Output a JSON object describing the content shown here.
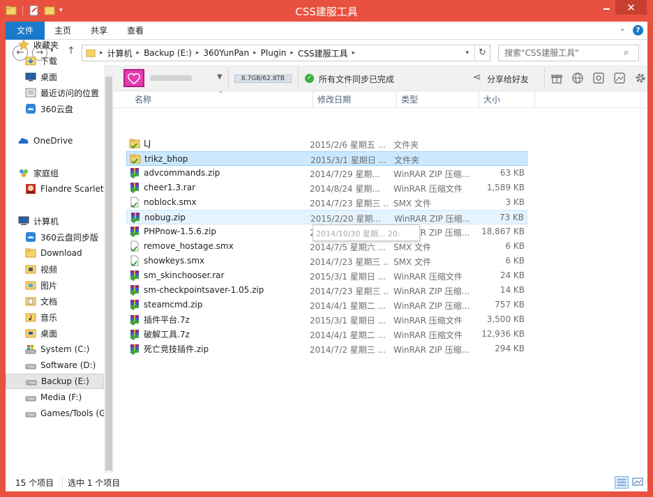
{
  "window": {
    "title": "CSS建服工具"
  },
  "ribbon": {
    "tabs": [
      "文件",
      "主页",
      "共享",
      "查看"
    ]
  },
  "address": {
    "crumbs": [
      "计算机",
      "Backup (E:)",
      "360YunPan",
      "Plugin",
      "CSS建服工具"
    ],
    "search_placeholder": "搜索\"CSS建服工具\""
  },
  "nav": {
    "items": [
      {
        "label": "收藏夹",
        "icon": "star-icon",
        "indent": 0
      },
      {
        "label": "下载",
        "icon": "download-folder-icon",
        "indent": 1
      },
      {
        "label": "桌面",
        "icon": "desktop-icon",
        "indent": 1
      },
      {
        "label": "最近访问的位置",
        "icon": "recent-places-icon",
        "indent": 1
      },
      {
        "label": "360云盘",
        "icon": "cloud-drive-icon",
        "indent": 1
      },
      {
        "label": "OneDrive",
        "icon": "onedrive-icon",
        "indent": 0
      },
      {
        "label": "家庭组",
        "icon": "homegroup-icon",
        "indent": 0
      },
      {
        "label": "Flandre Scarlet",
        "icon": "user-avatar-icon",
        "indent": 1
      },
      {
        "label": "计算机",
        "icon": "computer-icon",
        "indent": 0
      },
      {
        "label": "360云盘同步版",
        "icon": "cloud-drive-icon",
        "indent": 1
      },
      {
        "label": "Download",
        "icon": "folder-icon",
        "indent": 1
      },
      {
        "label": "视频",
        "icon": "videos-folder-icon",
        "indent": 1
      },
      {
        "label": "图片",
        "icon": "pictures-folder-icon",
        "indent": 1
      },
      {
        "label": "文档",
        "icon": "documents-folder-icon",
        "indent": 1
      },
      {
        "label": "音乐",
        "icon": "music-folder-icon",
        "indent": 1
      },
      {
        "label": "桌面",
        "icon": "desktop-folder-icon",
        "indent": 1
      },
      {
        "label": "System (C:)",
        "icon": "system-drive-icon",
        "indent": 1
      },
      {
        "label": "Software (D:)",
        "icon": "drive-icon",
        "indent": 1
      },
      {
        "label": "Backup (E:)",
        "icon": "drive-icon",
        "indent": 1
      },
      {
        "label": "Media (F:)",
        "icon": "drive-icon",
        "indent": 1
      },
      {
        "label": "Games/Tools (G",
        "icon": "drive-icon",
        "indent": 1
      }
    ]
  },
  "toolbar360": {
    "quota": "8.7GB/62.8TB",
    "sync_status": "所有文件同步已完成",
    "share_label": "分享给好友",
    "accent": "#cc2a9a"
  },
  "columns": {
    "name": "名称",
    "date": "修改日期",
    "type": "类型",
    "size": "大小"
  },
  "files": [
    {
      "name": "LJ",
      "date": "2015/2/6 星期五 ...",
      "type": "文件夹",
      "size": "",
      "icon": "folder-icon",
      "state": ""
    },
    {
      "name": "trikz_bhop",
      "date": "2015/3/1 星期日 ...",
      "type": "文件夹",
      "size": "",
      "icon": "folder-icon",
      "state": "selected"
    },
    {
      "name": "advcommands.zip",
      "date": "2014/7/29 星期...",
      "type": "WinRAR ZIP 压缩...",
      "size": "63 KB",
      "icon": "winrar-icon",
      "state": ""
    },
    {
      "name": "cheer1.3.rar",
      "date": "2014/8/24 星期...",
      "type": "WinRAR 压缩文件",
      "size": "1,589 KB",
      "icon": "winrar-icon",
      "state": ""
    },
    {
      "name": "noblock.smx",
      "date": "2014/7/23 星期三 ...",
      "type": "SMX 文件",
      "size": "3 KB",
      "icon": "file-icon",
      "state": ""
    },
    {
      "name": "nobug.zip",
      "date": "2015/2/20 星期...",
      "type": "WinRAR ZIP 压缩...",
      "size": "73 KB",
      "icon": "winrar-icon",
      "state": "hover"
    },
    {
      "name": "PHPnow-1.5.6.zip",
      "date": "2014/10/30 星期...",
      "type": "WinRAR ZIP 压缩...",
      "size": "18,867 KB",
      "icon": "winrar-icon",
      "state": ""
    },
    {
      "name": "remove_hostage.smx",
      "date": "2014/7/5 星期六 ...",
      "type": "SMX 文件",
      "size": "6 KB",
      "icon": "file-icon",
      "state": ""
    },
    {
      "name": "showkeys.smx",
      "date": "2014/7/23 星期三 ...",
      "type": "SMX 文件",
      "size": "6 KB",
      "icon": "file-icon",
      "state": ""
    },
    {
      "name": "sm_skinchooser.rar",
      "date": "2015/3/1 星期日 ...",
      "type": "WinRAR 压缩文件",
      "size": "24 KB",
      "icon": "winrar-icon",
      "state": ""
    },
    {
      "name": "sm-checkpointsaver-1.05.zip",
      "date": "2014/7/23 星期三 ...",
      "type": "WinRAR ZIP 压缩...",
      "size": "14 KB",
      "icon": "winrar-icon",
      "state": ""
    },
    {
      "name": "steamcmd.zip",
      "date": "2014/4/1 星期二 ...",
      "type": "WinRAR ZIP 压缩...",
      "size": "757 KB",
      "icon": "winrar-icon",
      "state": ""
    },
    {
      "name": "插件平台.7z",
      "date": "2015/3/1 星期日 ...",
      "type": "WinRAR 压缩文件",
      "size": "3,500 KB",
      "icon": "winrar-icon",
      "state": ""
    },
    {
      "name": "破解工具.7z",
      "date": "2014/4/1 星期二 ...",
      "type": "WinRAR 压缩文件",
      "size": "12,936 KB",
      "icon": "winrar-icon",
      "state": ""
    },
    {
      "name": "死亡竞技插件.zip",
      "date": "2014/7/2 星期三 ...",
      "type": "WinRAR ZIP 压缩...",
      "size": "294 KB",
      "icon": "winrar-icon",
      "state": ""
    }
  ],
  "tooltip": {
    "text": "2014/10/30 星期... 20:"
  },
  "status": {
    "count": "15 个项目",
    "selection": "选中 1 个项目"
  }
}
